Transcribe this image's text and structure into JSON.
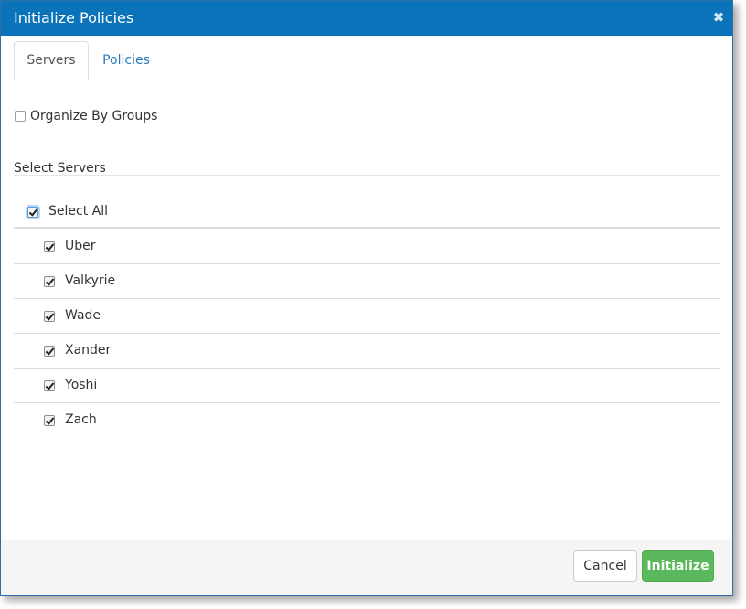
{
  "dialog": {
    "title": "Initialize Policies",
    "close_glyph": "✖"
  },
  "tabs": [
    {
      "label": "Servers",
      "active": true
    },
    {
      "label": "Policies",
      "active": false
    }
  ],
  "organize_by_groups": {
    "label": "Organize By Groups",
    "checked": false
  },
  "select_servers": {
    "title": "Select Servers"
  },
  "select_all": {
    "label": "Select All",
    "checked": true
  },
  "servers": [
    {
      "label": "Uber",
      "checked": true
    },
    {
      "label": "Valkyrie",
      "checked": true
    },
    {
      "label": "Wade",
      "checked": true
    },
    {
      "label": "Xander",
      "checked": true
    },
    {
      "label": "Yoshi",
      "checked": true
    },
    {
      "label": "Zach",
      "checked": true
    }
  ],
  "footer": {
    "cancel_label": "Cancel",
    "initialize_label": "Initialize"
  },
  "colors": {
    "header": "#0a73b9",
    "link": "#2a7ab8",
    "primary_button": "#5cb85c"
  },
  "icons": {
    "close": "close-icon",
    "checkbox": "checkbox-icon"
  }
}
